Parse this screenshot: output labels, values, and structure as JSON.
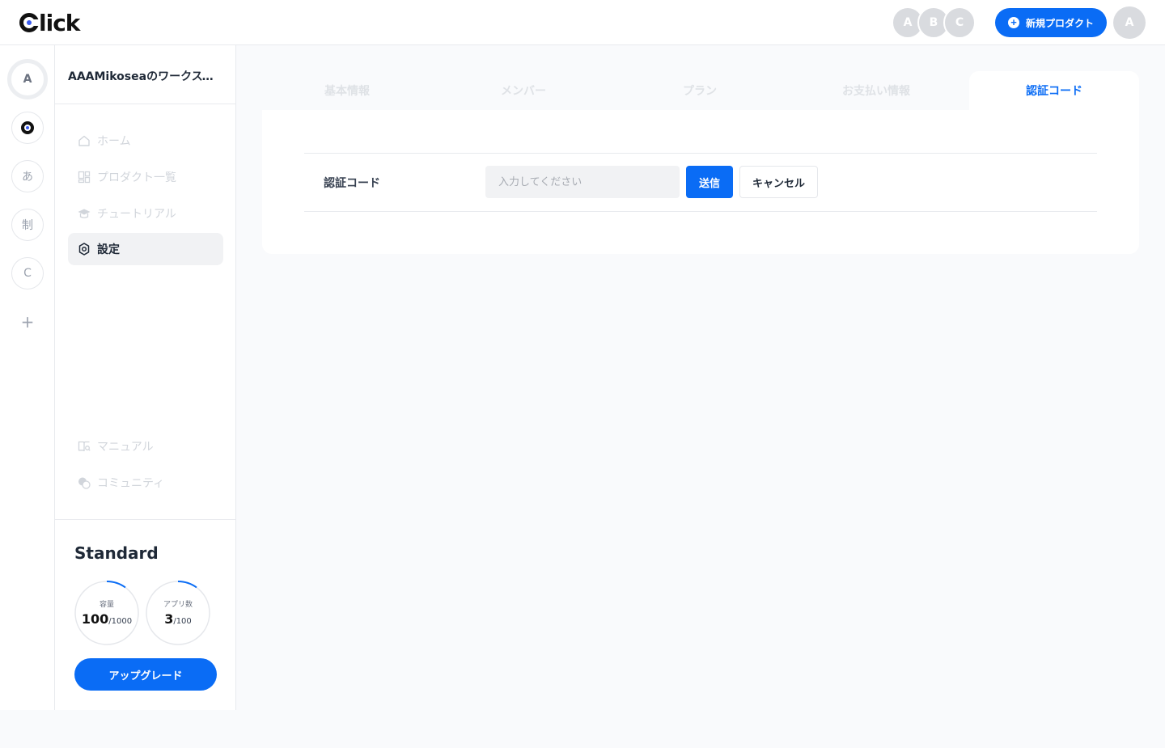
{
  "header": {
    "logo_text": "lick",
    "members": [
      "A",
      "B",
      "C"
    ],
    "new_product_label": "新規プロダクト",
    "user_initial": "A"
  },
  "rail": {
    "workspaces": [
      "A",
      "",
      "あ",
      "制",
      "C"
    ],
    "add_label": "+"
  },
  "sidebar": {
    "workspace_title": "AAAMikoseaのワークスペース",
    "nav": [
      {
        "label": "ホーム",
        "icon": "home-icon"
      },
      {
        "label": "プロダクト一覧",
        "icon": "grid-icon"
      },
      {
        "label": "チュートリアル",
        "icon": "graduation-cap-icon"
      },
      {
        "label": "設定",
        "icon": "gear-icon"
      }
    ],
    "bottom_nav": [
      {
        "label": "マニュアル",
        "icon": "book-icon"
      },
      {
        "label": "コミュニティ",
        "icon": "chat-bubbles-icon"
      }
    ],
    "plan": {
      "name": "Standard",
      "capacity_label": "容量",
      "capacity_used": "100",
      "capacity_total": "/1000",
      "capacity_fraction": 0.1,
      "apps_label": "アプリ数",
      "apps_used": "3",
      "apps_total": "/100",
      "apps_fraction": 0.03,
      "upgrade_label": "アップグレード"
    }
  },
  "main": {
    "tabs": [
      "基本情報",
      "メンバー",
      "プラン",
      "お支払い情報",
      "認証コード"
    ],
    "active_tab": 4,
    "form": {
      "label": "認証コード",
      "placeholder": "入力してください",
      "submit_label": "送信",
      "cancel_label": "キャンセル"
    }
  },
  "colors": {
    "accent": "#0a6cf5",
    "avatar_gray": "#d9dbdf"
  }
}
